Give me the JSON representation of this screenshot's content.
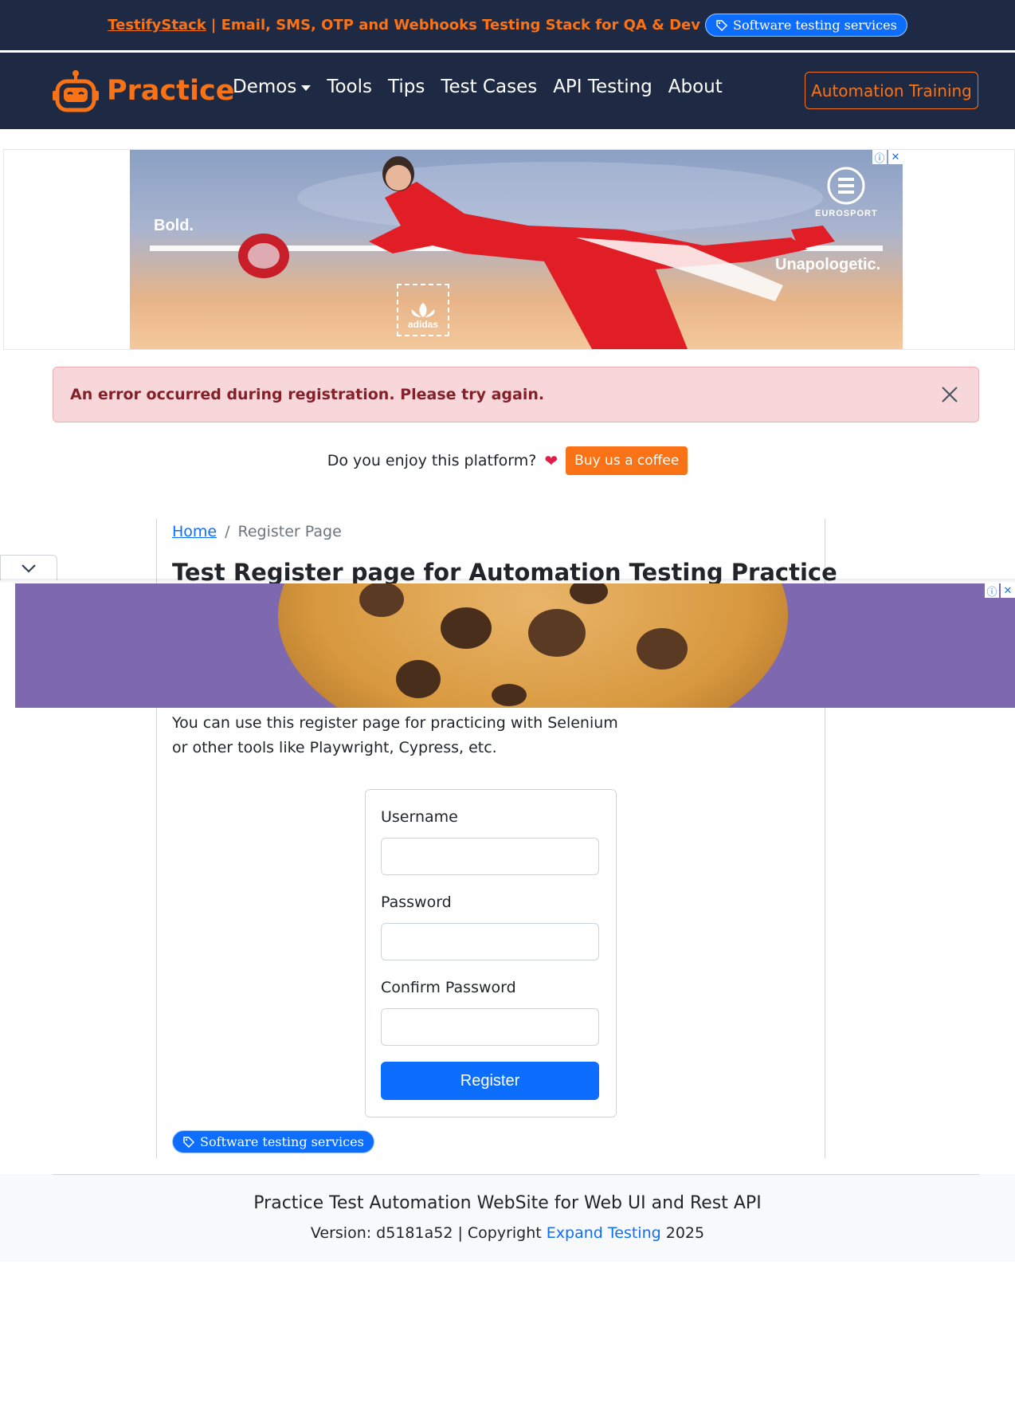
{
  "promo": {
    "link_text": "TestifyStack",
    "text": "| Email, SMS, OTP and Webhooks Testing Stack for QA & Dev",
    "pill_label": "Software testing services"
  },
  "navbar": {
    "brand": "Practice",
    "links": [
      {
        "label": "Demos"
      },
      {
        "label": "Tools"
      },
      {
        "label": "Tips"
      },
      {
        "label": "Test Cases"
      },
      {
        "label": "API Testing"
      },
      {
        "label": "About"
      }
    ],
    "cta_label": "Automation Training"
  },
  "ad_top": {
    "left_text": "Bold.",
    "right_text": "Unapologetic.",
    "brand_mark": "adidas",
    "sponsor": "EUROSPORT",
    "info_icon": "ⓘ",
    "close_icon": "✕"
  },
  "alert": {
    "message": "An error occurred during registration. Please try again."
  },
  "coffee": {
    "question": "Do you enjoy this platform?",
    "heart": "❤",
    "button_label": "Buy us a coffee"
  },
  "breadcrumb": {
    "home": "Home",
    "separator": "/",
    "current": "Register Page"
  },
  "page": {
    "title": "Test Register page for Automation Testing Practice",
    "intro": "You can use this register page for practicing with Selenium or other tools like Playwright, Cypress, etc."
  },
  "form": {
    "username_label": "Username",
    "password_label": "Password",
    "confirm_label": "Confirm Password",
    "submit_label": "Register"
  },
  "footer_pill": {
    "label": "Software testing services"
  },
  "footer": {
    "title": "Practice Test Automation WebSite for Web UI and Rest API",
    "version_prefix": "Version: d5181a52 | Copyright",
    "company": "Expand Testing",
    "year": "2025"
  },
  "colors": {
    "navy": "#1e2a44",
    "orange": "#f97316",
    "primary": "#0d6efd",
    "alert_bg": "#f8d7da",
    "alert_text": "#842029"
  }
}
